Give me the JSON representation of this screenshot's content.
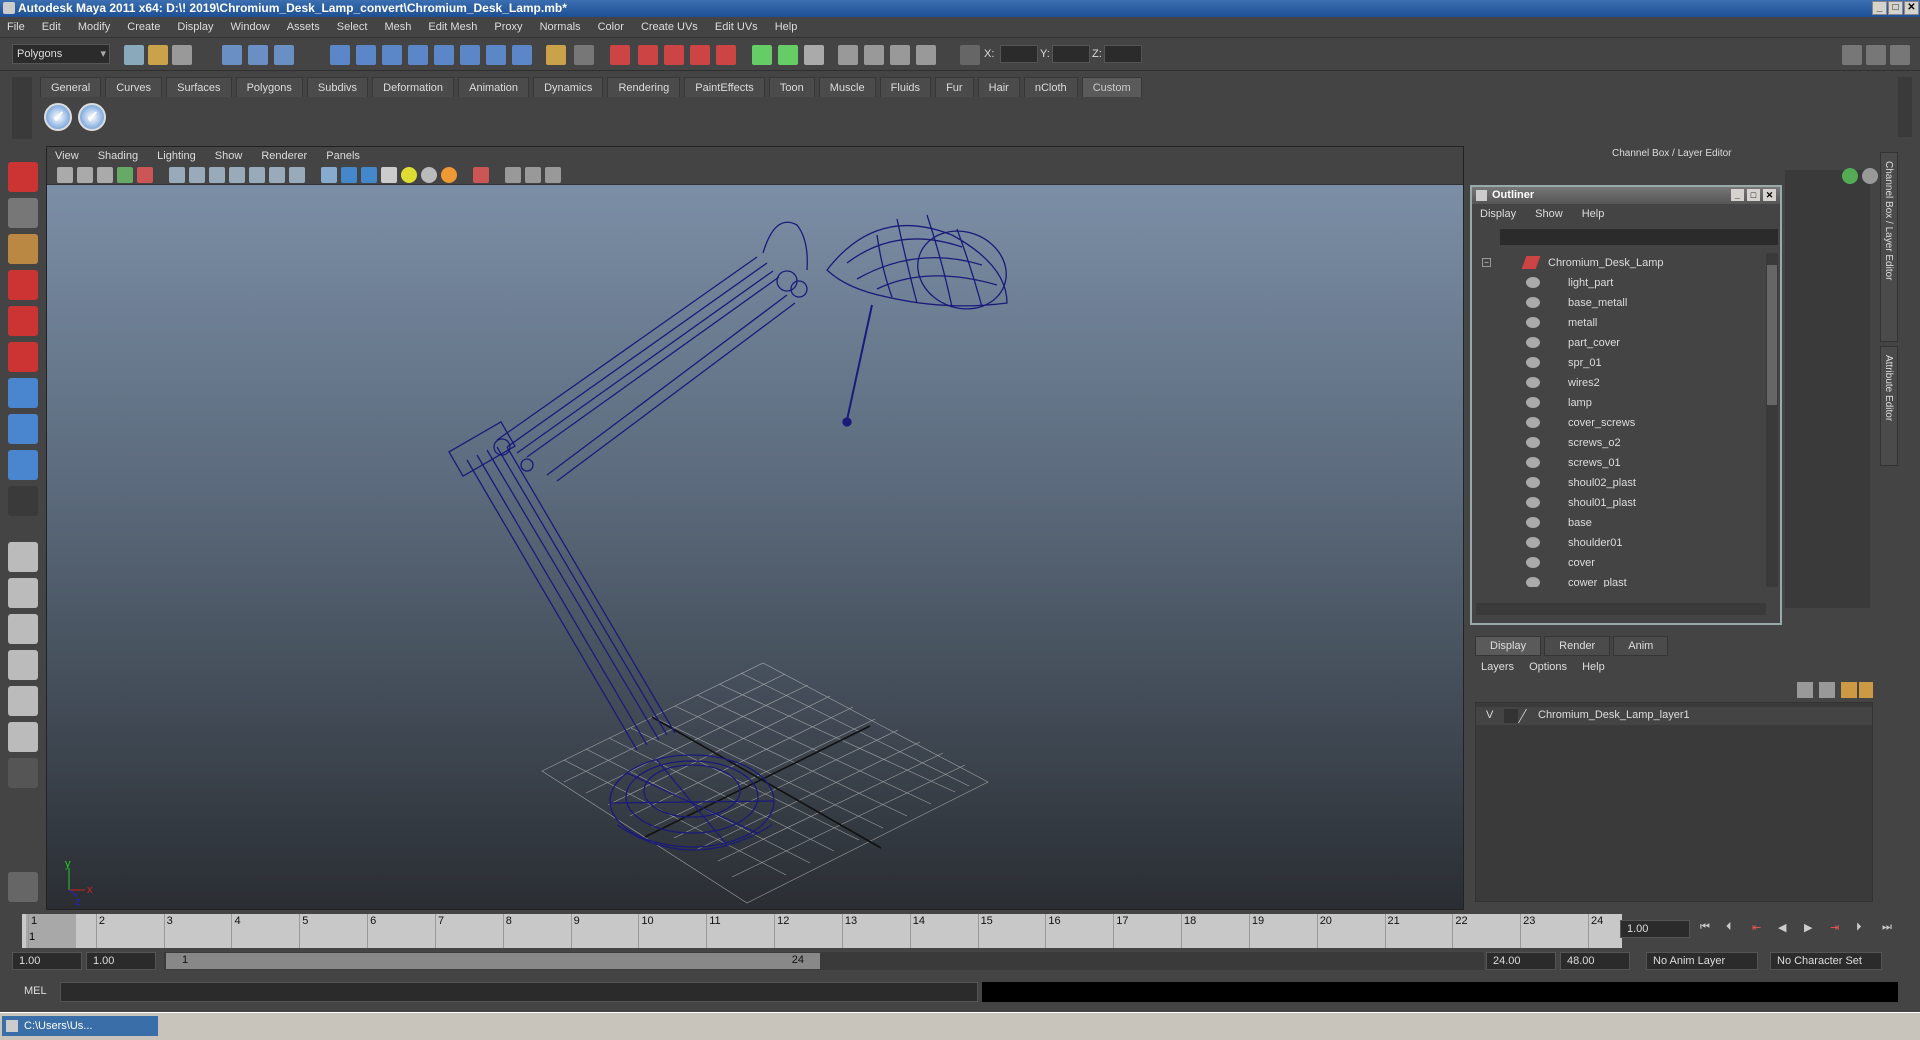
{
  "window": {
    "title": "Autodesk Maya 2011 x64: D:\\! 2019\\Chromium_Desk_Lamp_convert\\Chromium_Desk_Lamp.mb*",
    "minimize": "_",
    "maximize": "□",
    "close": "✕"
  },
  "menubar": [
    "File",
    "Edit",
    "Modify",
    "Create",
    "Display",
    "Window",
    "Assets",
    "Select",
    "Mesh",
    "Edit Mesh",
    "Proxy",
    "Normals",
    "Color",
    "Create UVs",
    "Edit UVs",
    "Help"
  ],
  "statusline": {
    "mode": "Polygons",
    "x_label": "X:",
    "y_label": "Y:",
    "z_label": "Z:"
  },
  "shelf": {
    "tabs": [
      "General",
      "Curves",
      "Surfaces",
      "Polygons",
      "Subdivs",
      "Deformation",
      "Animation",
      "Dynamics",
      "Rendering",
      "PaintEffects",
      "Toon",
      "Muscle",
      "Fluids",
      "Fur",
      "Hair",
      "nCloth",
      "Custom"
    ],
    "active_tab": "Custom"
  },
  "viewport": {
    "menus": [
      "View",
      "Shading",
      "Lighting",
      "Show",
      "Renderer",
      "Panels"
    ],
    "axis_y": "y",
    "axis_x": "x",
    "axis_z": "z",
    "wire_color": "#1a1a7a"
  },
  "channel_box": {
    "title": "Channel Box / Layer Editor",
    "side_tab_1": "Channel Box / Layer Editor",
    "side_tab_2": "Attribute Editor"
  },
  "outliner": {
    "title": "Outliner",
    "menus": [
      "Display",
      "Show",
      "Help"
    ],
    "root": "Chromium_Desk_Lamp",
    "items": [
      "light_part",
      "base_metall",
      "metall",
      "part_cover",
      "spr_01",
      "wires2",
      "lamp",
      "cover_screws",
      "screws_o2",
      "screws_01",
      "shoul02_plast",
      "shoul01_plast",
      "base",
      "shoulder01",
      "cover",
      "cower_plast"
    ]
  },
  "layer_editor": {
    "tabs": [
      "Display",
      "Render",
      "Anim"
    ],
    "active_tab": "Display",
    "menus": [
      "Layers",
      "Options",
      "Help"
    ],
    "layer_visible": "V",
    "layer_name": "Chromium_Desk_Lamp_layer1"
  },
  "timeline": {
    "ticks": [
      "1",
      "2",
      "3",
      "4",
      "5",
      "6",
      "7",
      "8",
      "9",
      "10",
      "11",
      "12",
      "13",
      "14",
      "15",
      "16",
      "17",
      "18",
      "19",
      "20",
      "21",
      "22",
      "23",
      "24"
    ],
    "current_frame": "1",
    "current_time": "1.00"
  },
  "range": {
    "start_time": "1.00",
    "playback_start": "1.00",
    "slider_start": "1",
    "slider_end": "24",
    "playback_end": "24.00",
    "end_time": "48.00",
    "anim_layer": "No Anim Layer",
    "character_set": "No Character Set"
  },
  "command_line": {
    "label": "MEL"
  },
  "taskbar": {
    "item": "C:\\Users\\Us..."
  }
}
